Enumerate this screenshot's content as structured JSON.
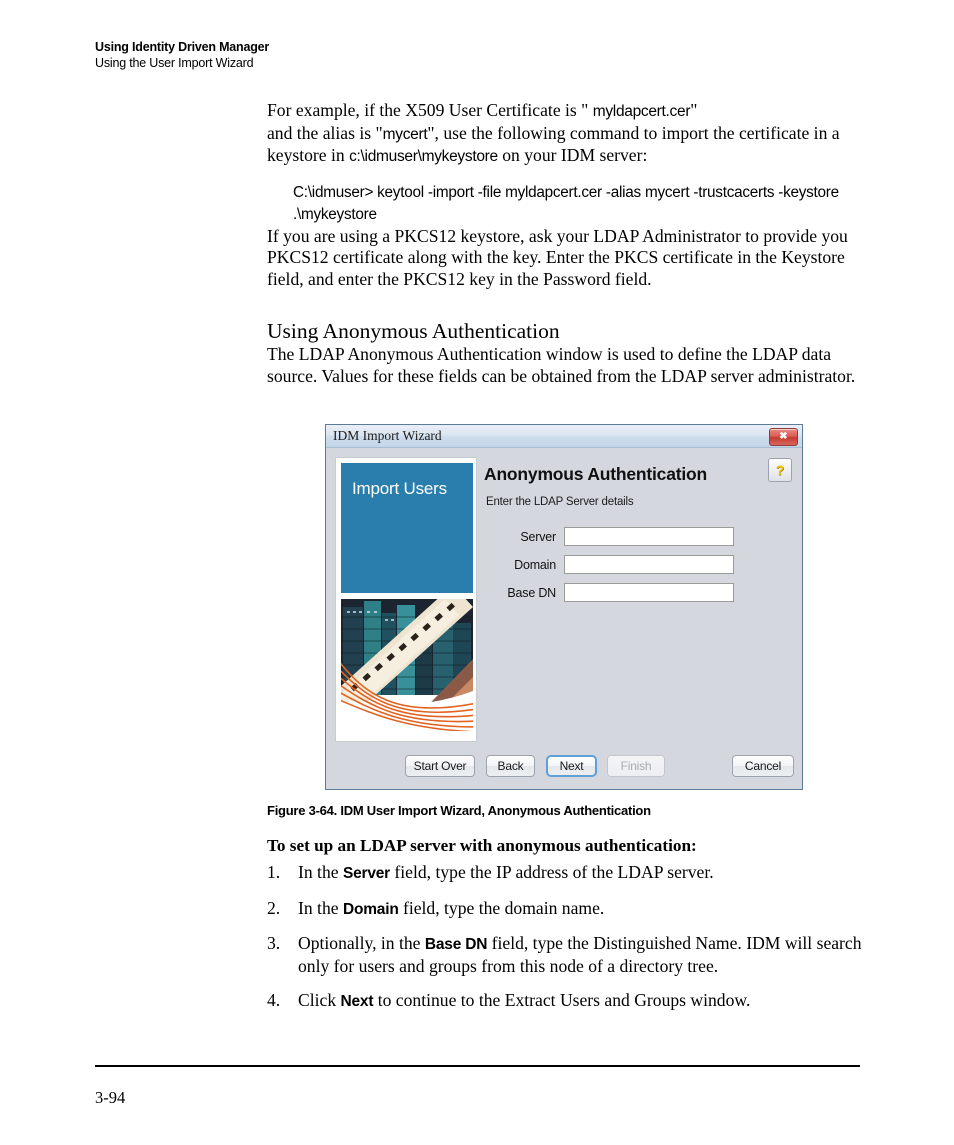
{
  "running_head": {
    "line1": "Using Identity Driven Manager",
    "line2": "Using the User Import Wizard"
  },
  "intro": {
    "p1_a": "For example, if the X509 User Certificate is \" ",
    "p1_code1": "myldapcert.cer",
    "p1_b": "\"",
    "p1_c": "and the alias is \"",
    "p1_code2": "mycert",
    "p1_d": "\", use the following command to import the certificate in a",
    "p1_e": "keystore in ",
    "p1_code3": "c:\\idmuser\\mykeystore",
    "p1_f": " on your IDM server:",
    "command": "C:\\idmuser> keytool -import -file myldapcert.cer -alias mycert -trustcacerts -keystore .\\mykeystore",
    "p2": "If you are using a PKCS12 keystore, ask your LDAP Administrator to provide you PKCS12 certificate along with the key. Enter the PKCS certificate in the Keystore field, and enter the PKCS12 key in the Password field."
  },
  "section": {
    "heading": "Using Anonymous Authentication",
    "paragraph": "The LDAP Anonymous Authentication window is used to define the LDAP data source. Values for these fields can be obtained from the LDAP server administrator."
  },
  "dialog": {
    "title": "IDM Import Wizard",
    "close_label": "✖",
    "sidebar_title": "Import Users",
    "pane_title": "Anonymous Authentication",
    "pane_subtitle": "Enter the LDAP Server details",
    "help_label": "?",
    "fields": [
      {
        "label": "Server",
        "value": "",
        "placeholder": ""
      },
      {
        "label": "Domain",
        "value": "",
        "placeholder": ""
      },
      {
        "label": "Base DN",
        "value": "",
        "placeholder": ""
      }
    ],
    "buttons": {
      "start_over": "Start Over",
      "back": "Back",
      "next": "Next",
      "finish": "Finish",
      "cancel": "Cancel"
    },
    "colors": {
      "brand_blue": "#2a7eae",
      "dialog_bg": "#d4d8de",
      "titlebar": "#ccdcec",
      "close_red": "#c4392f",
      "focus_blue": "#5d9fd6",
      "help_yellow": "#f2c200",
      "accent_orange": "#e2621f"
    }
  },
  "figure": {
    "caption": "Figure 3-64. IDM User Import Wizard, Anonymous Authentication"
  },
  "task": {
    "heading": "To set up an LDAP server with anonymous authentication:",
    "steps": [
      {
        "num": "1.",
        "a": "In the ",
        "bold": "Server",
        "b": " field, type the IP address of the LDAP server."
      },
      {
        "num": "2.",
        "a": "In the ",
        "bold": "Domain",
        "b": " field, type the domain name."
      },
      {
        "num": "3.",
        "a": "Optionally, in the ",
        "bold": "Base DN",
        "b": " field, type the Distinguished Name. IDM will search only for users and groups from this node of a directory tree."
      },
      {
        "num": "4.",
        "a": "Click ",
        "bold": "Next",
        "b": " to continue to the Extract Users and Groups window."
      }
    ]
  },
  "footer": {
    "page_number": "3-94"
  }
}
